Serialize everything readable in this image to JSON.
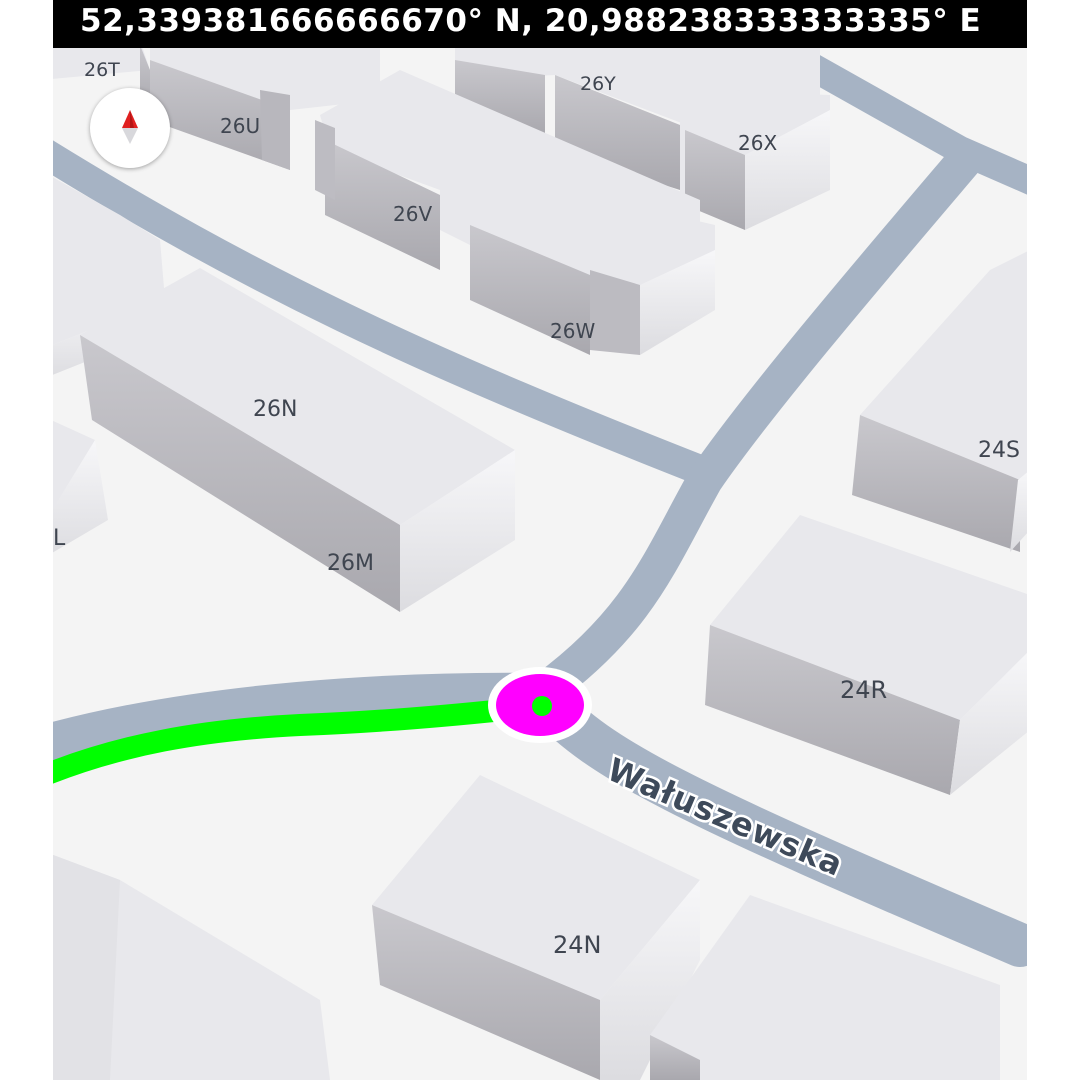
{
  "coordinates_text": "52,339381666666670° N, 20,988238333333335° E",
  "street_name": "Wałuszewska",
  "building_labels": {
    "b26T": "26T",
    "b26U": "26U",
    "b26Y": "26Y",
    "b26X": "26X",
    "b26V": "26V",
    "b26W": "26W",
    "b26N": "26N",
    "b26M": "26M",
    "bL": "L",
    "b24S": "24S",
    "b24R": "24R",
    "b24N": "24N"
  },
  "colors": {
    "road": "#a6b3c4",
    "route": "#00ff00",
    "position_marker": "#ff00ff",
    "background": "#f4f4f4",
    "building_top": "#e8e8ec",
    "compass_north": "#e02020"
  },
  "icons": {
    "compass": "compass-icon",
    "position": "current-location-icon"
  }
}
